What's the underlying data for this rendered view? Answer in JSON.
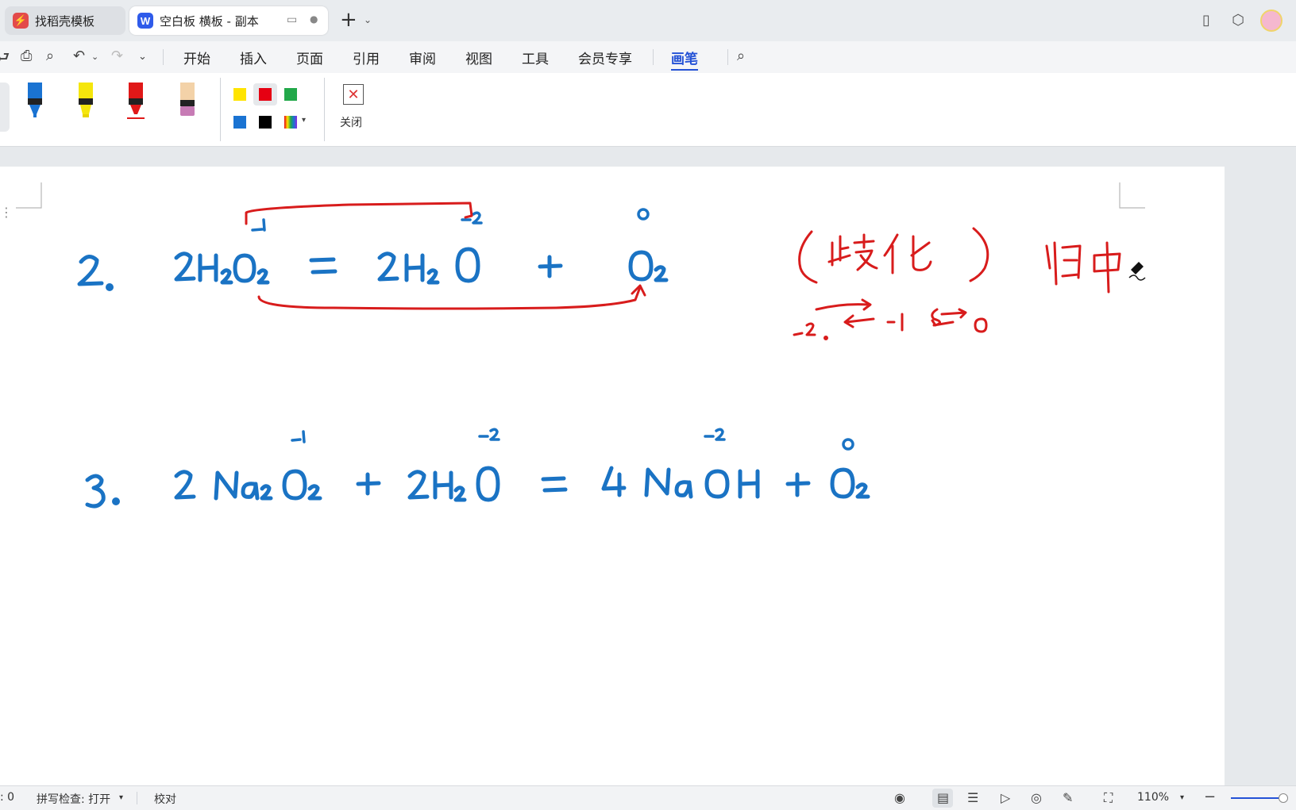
{
  "tabs": [
    {
      "title": "找稻壳模板",
      "icon": "wps-docer-icon",
      "color": "#e34a4a"
    },
    {
      "title": "空白板 横板 - 副本",
      "icon": "wps-writer-icon",
      "color": "#2f5bea",
      "logo_letter": "W"
    }
  ],
  "new_tab_label": "+",
  "menu": {
    "items": [
      "开始",
      "插入",
      "页面",
      "引用",
      "审阅",
      "视图",
      "工具",
      "会员专享",
      "画笔"
    ],
    "active": "画笔"
  },
  "pens": [
    {
      "name": "blue-pen",
      "color": "#1a73d2"
    },
    {
      "name": "yellow-highlighter",
      "color": "#f5e60c"
    },
    {
      "name": "red-pen",
      "color": "#e01818"
    },
    {
      "name": "eraser",
      "color": "#f3d2a8"
    }
  ],
  "colors": [
    "#ffe400",
    "#e60012",
    "#22a84a",
    "#1a73d2",
    "#000000"
  ],
  "selected_color": "#e60012",
  "close_label": "关闭",
  "ink": {
    "blue": "#1a73c4",
    "red": "#d81c1c"
  },
  "status": {
    "count": ": 0",
    "spellcheck": "拼写检查: 打开",
    "proofread": "校对",
    "zoom": "110%"
  }
}
